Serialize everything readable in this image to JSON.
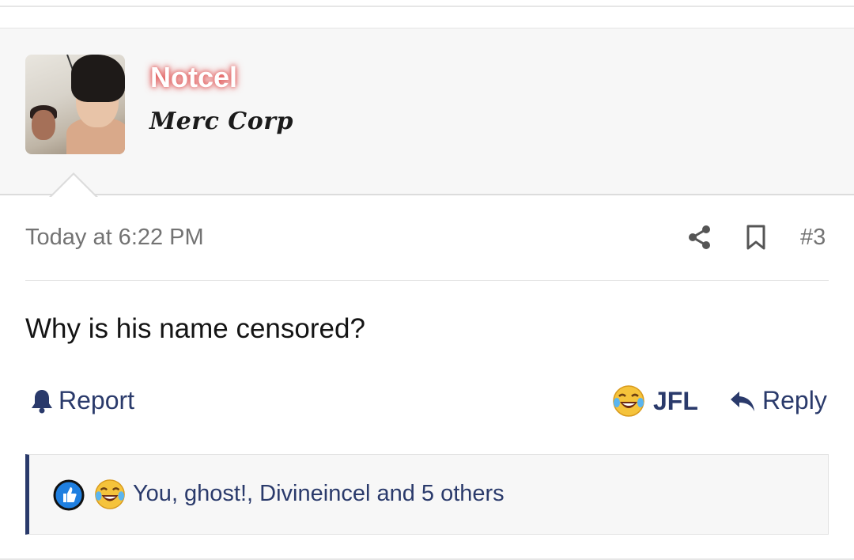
{
  "user": {
    "name": "Notcel",
    "title": "Merc Corp"
  },
  "post": {
    "date": "Today at 6:22 PM",
    "number": "#3",
    "body": "Why is his name censored?"
  },
  "actions": {
    "report_label": "Report",
    "jfl_label": "JFL",
    "reply_label": "Reply"
  },
  "reactions": {
    "summary": "You, ghost!, Divineincel and 5 others",
    "icons": [
      "like-icon",
      "jfl-emoji-icon"
    ]
  },
  "colors": {
    "accent": "#2a3a6b",
    "username_glow": "#e05050",
    "muted_text": "#737373",
    "user_block_bg": "#f7f7f7"
  }
}
